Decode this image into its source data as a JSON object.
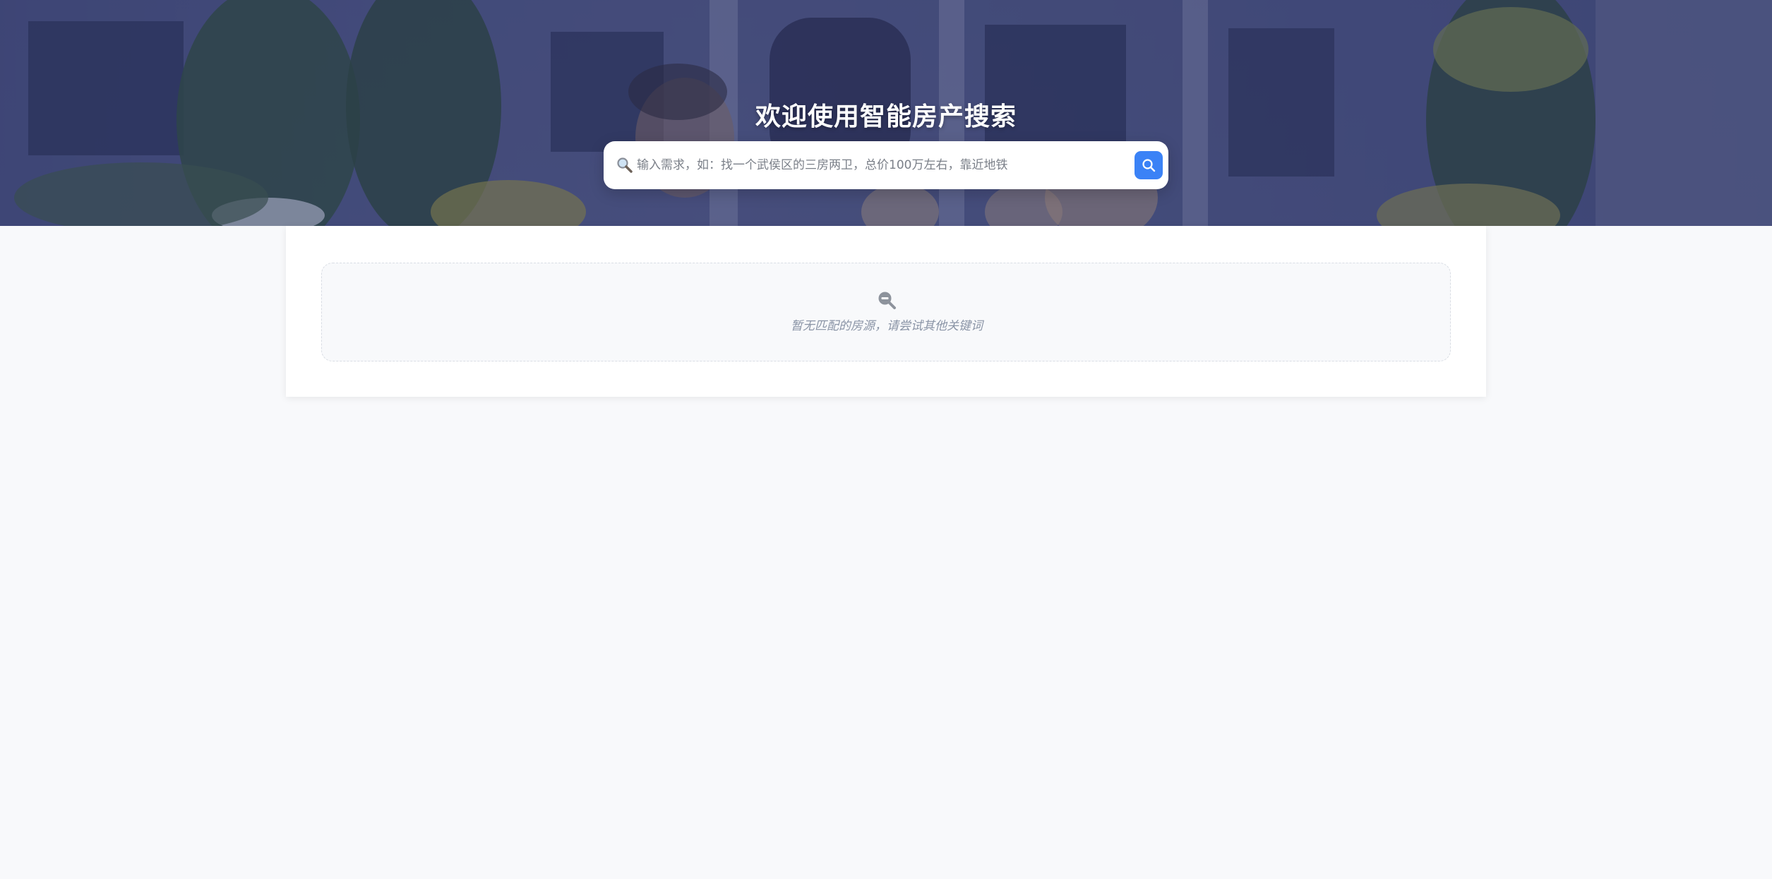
{
  "hero": {
    "title": "欢迎使用智能房产搜索"
  },
  "search": {
    "placeholder": "输入需求，如：找一个武侯区的三房两卫，总价100万左右，靠近地铁",
    "value": "",
    "leading_icon": "magnifier-emoji-icon",
    "button_icon": "search-icon",
    "button_color": "#3b82f6"
  },
  "results": {
    "empty_icon": "zoom-out-icon",
    "empty_message": "暂无匹配的房源，请尝试其他关键词"
  }
}
